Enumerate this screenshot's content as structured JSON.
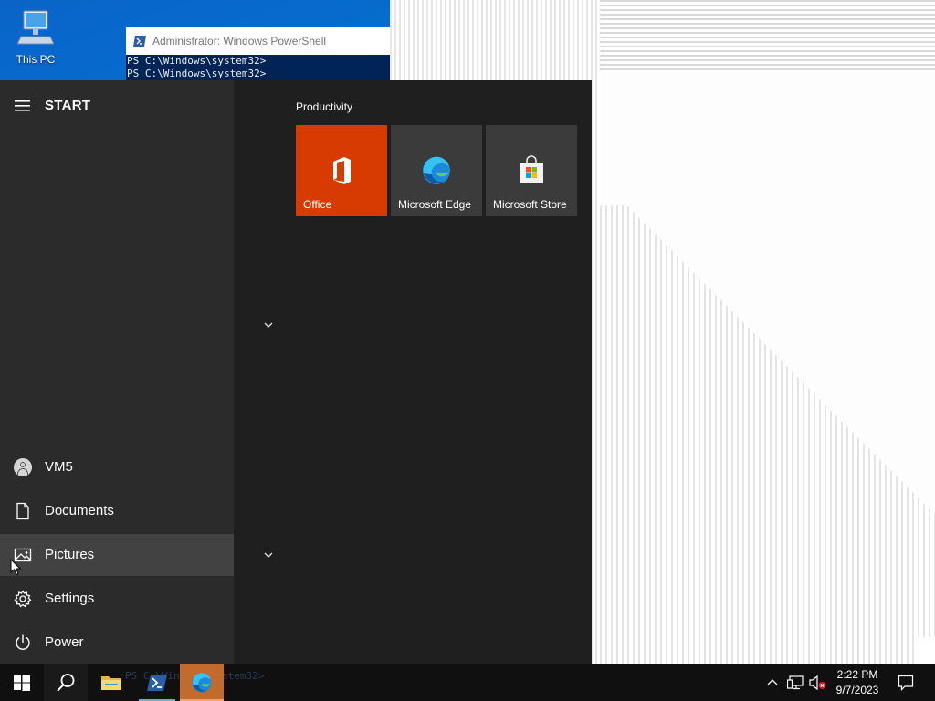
{
  "desktop": {
    "icons": [
      {
        "label": "This PC",
        "icon": "computer-icon"
      }
    ]
  },
  "powershell": {
    "title": "Administrator: Windows PowerShell",
    "lines": [
      "PS C:\\Windows\\system32>",
      "PS C:\\Windows\\system32>"
    ],
    "colors": {
      "background": "#012456",
      "text": "#eeedf0"
    }
  },
  "start_menu": {
    "title": "START",
    "left_items": [
      {
        "label": "VM5",
        "icon": "user-avatar-icon"
      },
      {
        "label": "Documents",
        "icon": "document-icon"
      },
      {
        "label": "Pictures",
        "icon": "picture-icon",
        "highlighted": true
      },
      {
        "label": "Settings",
        "icon": "gear-icon"
      },
      {
        "label": "Power",
        "icon": "power-icon"
      }
    ],
    "tiles_group": {
      "heading": "Productivity",
      "tiles": [
        {
          "label": "Office",
          "icon": "office-icon",
          "color": "#d83b01"
        },
        {
          "label": "Microsoft Edge",
          "icon": "edge-icon",
          "color": "#3b3b3b"
        },
        {
          "label": "Microsoft Store",
          "icon": "store-icon",
          "color": "#3b3b3b"
        }
      ]
    }
  },
  "taskbar": {
    "buttons": [
      {
        "name": "start",
        "icon": "windows-logo-icon"
      },
      {
        "name": "search",
        "icon": "search-icon"
      },
      {
        "name": "file-explorer",
        "icon": "folder-icon"
      },
      {
        "name": "powershell",
        "icon": "powershell-icon"
      },
      {
        "name": "edge",
        "icon": "edge-icon",
        "active": true
      }
    ],
    "ghost_text": "PS C:\\Windows\\system32>",
    "tray": {
      "time": "2:22 PM",
      "date": "9/7/2023",
      "icons": [
        "chevron-up-icon",
        "network-icon",
        "volume-muted-icon",
        "notification-icon"
      ]
    }
  },
  "colors": {
    "accent": "#0078d7",
    "start_bg": "#1f1f1f",
    "start_left_bg": "#2b2b2b",
    "highlight": "#424242",
    "taskbar_bg": "#101010",
    "edge_taskbar_active": "#c36a2d"
  }
}
